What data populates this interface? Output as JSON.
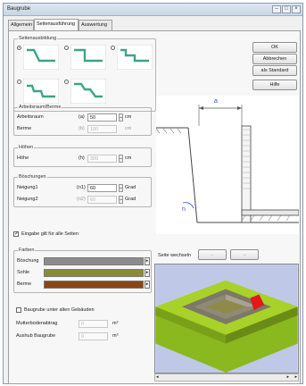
{
  "window": {
    "title": "Baugrube",
    "controls": [
      "–",
      "□",
      "×"
    ]
  },
  "tabs": [
    "Allgemein",
    "Seitenausführung",
    "Auswertung"
  ],
  "active_tab_index": 1,
  "side_shapes": {
    "label": "Seitenausbildung",
    "selected_index": 0
  },
  "buttons": {
    "ok": "OK",
    "cancel": "Abbrechen",
    "default": "als Standard",
    "help": "Hilfe"
  },
  "work_space": {
    "title": "Arbeitsraum/Berme",
    "rows": [
      {
        "label": "Arbeitsraum",
        "var": "(a)",
        "value": "50",
        "unit": "cm",
        "disabled": false
      },
      {
        "label": "Berme",
        "var": "(b)",
        "value": "100",
        "unit": "cm",
        "disabled": true
      }
    ]
  },
  "heights": {
    "title": "Höhen",
    "rows": [
      {
        "label": "Höhe",
        "var": "(h)",
        "value": "300",
        "unit": "cm",
        "disabled": true
      }
    ]
  },
  "slopes": {
    "title": "Böschungen",
    "rows": [
      {
        "label": "Neigung1",
        "var": "(n1)",
        "value": "60",
        "unit": "Grad",
        "disabled": false
      },
      {
        "label": "Neigung2",
        "var": "(n2)",
        "value": "60",
        "unit": "Grad",
        "disabled": true
      }
    ]
  },
  "apply_all": {
    "label": "Eingabe gilt für alle Seiten",
    "checked": true
  },
  "diagram": {
    "dimension_label": "a",
    "slope_label": "n"
  },
  "colors": {
    "title": "Farben",
    "rows": [
      {
        "label": "Böschung",
        "color": "#8c8c8c"
      },
      {
        "label": "Sohle",
        "color": "#8b8b36"
      },
      {
        "label": "Berme",
        "color": "#8b4513"
      }
    ]
  },
  "existing": {
    "checkbox_label": "Baugrube unter alten Gebäuden",
    "checked": false,
    "rows": [
      {
        "label": "Mutterbodenabtrag",
        "value": "0",
        "unit": "m³"
      },
      {
        "label": "Aushub Baugrube",
        "value": "0",
        "unit": "m³"
      }
    ]
  },
  "side_switch": {
    "label": "Seite wechseln",
    "prev": "←",
    "next": "→"
  },
  "view_colors": {
    "bg": "#bfc8e6",
    "ground": "#a8d22a",
    "pit": "#8f8a77",
    "floor": "#8f8a4a",
    "highlight": "#e01a1a"
  }
}
